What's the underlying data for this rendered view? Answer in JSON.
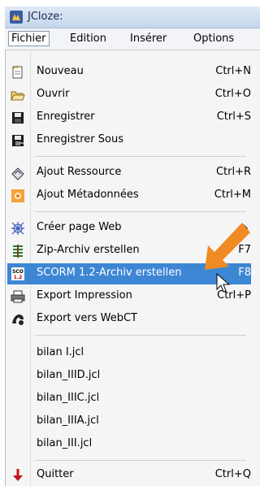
{
  "window": {
    "title": "JCloze:"
  },
  "menubar": [
    "Fichier",
    "Edition",
    "Insérer",
    "Options"
  ],
  "menu": {
    "items": [
      {
        "label": "Nouveau",
        "shortcut": "Ctrl+N",
        "icon": "new-document-icon"
      },
      {
        "label": "Ouvrir",
        "shortcut": "Ctrl+O",
        "icon": "open-folder-icon"
      },
      {
        "label": "Enregistrer",
        "shortcut": "Ctrl+S",
        "icon": "save-disk-icon"
      },
      {
        "label": "Enregistrer Sous",
        "shortcut": "",
        "icon": "save-as-icon"
      },
      {
        "label": "Ajout Ressource",
        "shortcut": "Ctrl+R",
        "icon": "resource-icon"
      },
      {
        "label": "Ajout Métadonnées",
        "shortcut": "Ctrl+M",
        "icon": "metadata-icon"
      },
      {
        "label": "Créer page Web",
        "shortcut": "",
        "icon": "web-page-icon"
      },
      {
        "label": "Zip-Archiv erstellen",
        "shortcut": "F7",
        "icon": "zip-icon"
      },
      {
        "label": "SCORM 1.2-Archiv erstellen",
        "shortcut": "F8",
        "icon": "scorm-icon"
      },
      {
        "label": "Export Impression",
        "shortcut": "Ctrl+P",
        "icon": "print-icon"
      },
      {
        "label": "Export vers WebCT",
        "shortcut": "",
        "icon": "webct-icon"
      },
      {
        "label": "bilan I.jcl",
        "shortcut": ""
      },
      {
        "label": "bilan_IIID.jcl",
        "shortcut": ""
      },
      {
        "label": "bilan_IIIC.jcl",
        "shortcut": ""
      },
      {
        "label": "bilan_IIIA.jcl",
        "shortcut": ""
      },
      {
        "label": "bilan_III.jcl",
        "shortcut": ""
      },
      {
        "label": "Quitter",
        "shortcut": "Ctrl+Q",
        "icon": "exit-icon"
      }
    ]
  },
  "colors": {
    "highlight": "#3d86d4",
    "arrow": "#f08a24"
  }
}
